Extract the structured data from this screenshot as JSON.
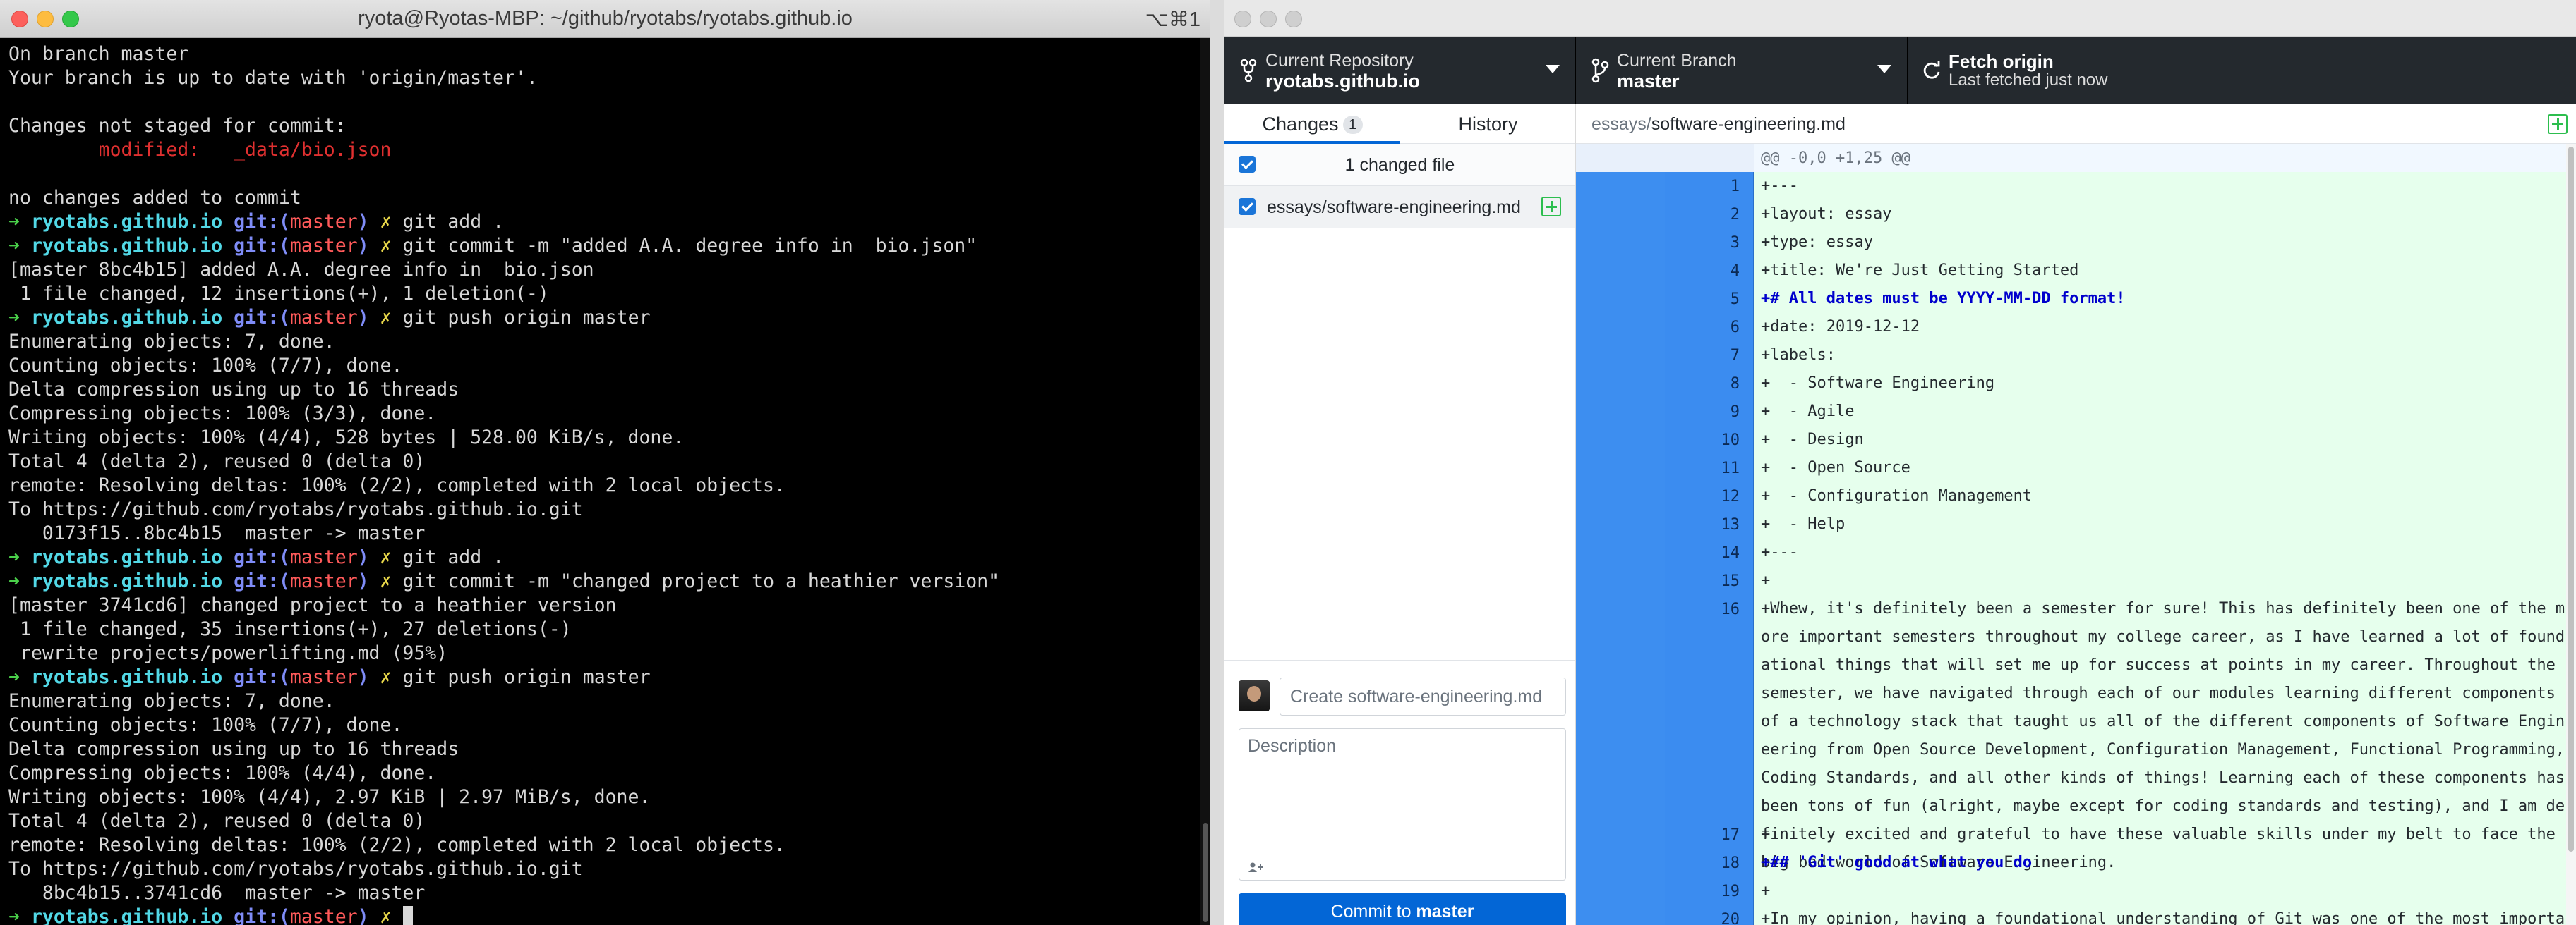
{
  "terminal": {
    "title": "ryota@Ryotas-MBP: ~/github/ryotabs/ryotabs.github.io",
    "shortcut": "⌥⌘1",
    "prompt": {
      "arrow": "➜",
      "dir": "ryotabs.github.io",
      "git": "git:(",
      "branch": "master",
      "git_close": ")",
      "dirty": "✗"
    },
    "lines": [
      {
        "t": "out",
        "v": "On branch master"
      },
      {
        "t": "out",
        "v": "Your branch is up to date with 'origin/master'."
      },
      {
        "t": "out",
        "v": ""
      },
      {
        "t": "out",
        "v": "Changes not staged for commit:"
      },
      {
        "t": "mod",
        "v": "        modified:   _data/bio.json"
      },
      {
        "t": "out",
        "v": ""
      },
      {
        "t": "out",
        "v": "no changes added to commit"
      },
      {
        "t": "cmd",
        "v": "git add ."
      },
      {
        "t": "cmd",
        "v": "git commit -m \"added A.A. degree info in  bio.json\""
      },
      {
        "t": "out",
        "v": "[master 8bc4b15] added A.A. degree info in  bio.json"
      },
      {
        "t": "out",
        "v": " 1 file changed, 12 insertions(+), 1 deletion(-)"
      },
      {
        "t": "cmd",
        "v": "git push origin master"
      },
      {
        "t": "out",
        "v": "Enumerating objects: 7, done."
      },
      {
        "t": "out",
        "v": "Counting objects: 100% (7/7), done."
      },
      {
        "t": "out",
        "v": "Delta compression using up to 16 threads"
      },
      {
        "t": "out",
        "v": "Compressing objects: 100% (3/3), done."
      },
      {
        "t": "out",
        "v": "Writing objects: 100% (4/4), 528 bytes | 528.00 KiB/s, done."
      },
      {
        "t": "out",
        "v": "Total 4 (delta 2), reused 0 (delta 0)"
      },
      {
        "t": "out",
        "v": "remote: Resolving deltas: 100% (2/2), completed with 2 local objects."
      },
      {
        "t": "out",
        "v": "To https://github.com/ryotabs/ryotabs.github.io.git"
      },
      {
        "t": "out",
        "v": "   0173f15..8bc4b15  master -> master"
      },
      {
        "t": "cmd",
        "v": "git add ."
      },
      {
        "t": "cmd",
        "v": "git commit -m \"changed project to a heathier version\""
      },
      {
        "t": "out",
        "v": "[master 3741cd6] changed project to a heathier version"
      },
      {
        "t": "out",
        "v": " 1 file changed, 35 insertions(+), 27 deletions(-)"
      },
      {
        "t": "out",
        "v": " rewrite projects/powerlifting.md (95%)"
      },
      {
        "t": "cmd",
        "v": "git push origin master"
      },
      {
        "t": "out",
        "v": "Enumerating objects: 7, done."
      },
      {
        "t": "out",
        "v": "Counting objects: 100% (7/7), done."
      },
      {
        "t": "out",
        "v": "Delta compression using up to 16 threads"
      },
      {
        "t": "out",
        "v": "Compressing objects: 100% (4/4), done."
      },
      {
        "t": "out",
        "v": "Writing objects: 100% (4/4), 2.97 KiB | 2.97 MiB/s, done."
      },
      {
        "t": "out",
        "v": "Total 4 (delta 2), reused 0 (delta 0)"
      },
      {
        "t": "out",
        "v": "remote: Resolving deltas: 100% (2/2), completed with 2 local objects."
      },
      {
        "t": "out",
        "v": "To https://github.com/ryotabs/ryotabs.github.io.git"
      },
      {
        "t": "out",
        "v": "   8bc4b15..3741cd6  master -> master"
      },
      {
        "t": "cmd",
        "v": ""
      }
    ]
  },
  "desktop": {
    "toolbar": {
      "repo_label": "Current Repository",
      "repo_value": "ryotabs.github.io",
      "branch_label": "Current Branch",
      "branch_value": "master",
      "fetch_label": "Fetch origin",
      "fetch_sub": "Last fetched just now"
    },
    "tabs": {
      "changes": "Changes",
      "changes_count": "1",
      "history": "History"
    },
    "changed_files_header": "1 changed file",
    "file_name": "essays/software-engineering.md",
    "summary_placeholder": "Create software-engineering.md",
    "description_placeholder": "Description",
    "coauthor_icon": "add-coauthor-icon",
    "commit_button_prefix": "Commit to ",
    "commit_button_branch": "master",
    "diff": {
      "path_dir": "essays/",
      "path_file": "software-engineering.md",
      "hunk": "@@ -0,0 +1,25 @@",
      "lines": [
        {
          "n": "1",
          "v": "+---"
        },
        {
          "n": "2",
          "v": "+layout: essay"
        },
        {
          "n": "3",
          "v": "+type: essay"
        },
        {
          "n": "4",
          "v": "+title: We're Just Getting Started"
        },
        {
          "n": "5",
          "v": "+# All dates must be YYYY-MM-DD format!",
          "bold": true
        },
        {
          "n": "6",
          "v": "+date: 2019-12-12"
        },
        {
          "n": "7",
          "v": "+labels:"
        },
        {
          "n": "8",
          "v": "+  - Software Engineering"
        },
        {
          "n": "9",
          "v": "+  - Agile"
        },
        {
          "n": "10",
          "v": "+  - Design"
        },
        {
          "n": "11",
          "v": "+  - Open Source"
        },
        {
          "n": "12",
          "v": "+  - Configuration Management"
        },
        {
          "n": "13",
          "v": "+  - Help"
        },
        {
          "n": "14",
          "v": "+---"
        },
        {
          "n": "15",
          "v": "+"
        },
        {
          "n": "16",
          "v": "+Whew, it's definitely been a semester for sure! This has definitely been one of the more important semesters throughout my college career, as I have learned a lot of foundational things that will set me up for success at points in my career. Throughout the semester, we have navigated through each of our modules learning different components of a technology stack that taught us all of the different components of Software Engineering from Open Source Development, Configuration Management, Functional Programming, Coding Standards, and all other kinds of things! Learning each of these components has been tons of fun (alright, maybe except for coding standards and testing), and I am definitely excited and grateful to have these valuable skills under my belt to face the big bad world of Software Engineering.",
          "rows": 8
        },
        {
          "n": "17",
          "v": "+"
        },
        {
          "n": "18",
          "v": "+## 'Git' good at what you do",
          "bold": true
        },
        {
          "n": "19",
          "v": "+"
        },
        {
          "n": "20",
          "v": "+In my opinion, having a foundational understanding of Git was one of the most important"
        }
      ]
    }
  }
}
